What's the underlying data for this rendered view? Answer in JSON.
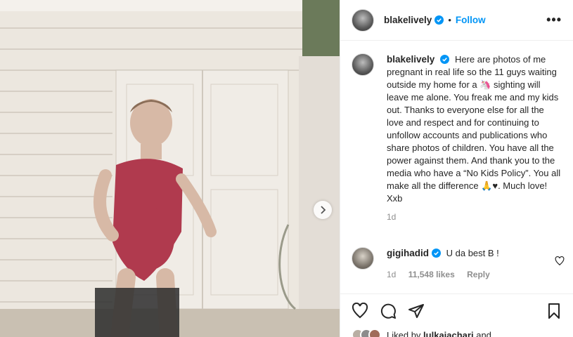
{
  "post": {
    "author": "blakelively",
    "follow_label": "Follow",
    "separator": "•",
    "more_label": "•••"
  },
  "caption": {
    "author": "blakelively",
    "text": "Here are photos of me pregnant in real life so the 11 guys waiting outside my home for a 🦄 sighting will leave me alone. You freak me and my kids out. Thanks to everyone else for all the love and respect and for continuing to unfollow accounts and publications who share photos of children. You have all the power against them. And thank you to the media who have a “No Kids Policy”. You all make all the difference 🙏♥. Much love! Xxb",
    "time": "1d"
  },
  "comment": {
    "author": "gigihadid",
    "text": "U da best B !",
    "time": "1d",
    "likes": "11,548 likes",
    "reply_label": "Reply"
  },
  "liked_by": {
    "prefix": "Liked by",
    "user": "lulkajachari",
    "suffix": "and"
  },
  "icons": {
    "verified": "verified-badge-icon",
    "next": "chevron-right-icon",
    "like": "heart-icon",
    "comment": "comment-icon",
    "share": "share-icon",
    "save": "bookmark-icon"
  },
  "colors": {
    "accent": "#0095f6",
    "muted": "#8e8e8e",
    "swimsuit": "#b03a4e"
  }
}
